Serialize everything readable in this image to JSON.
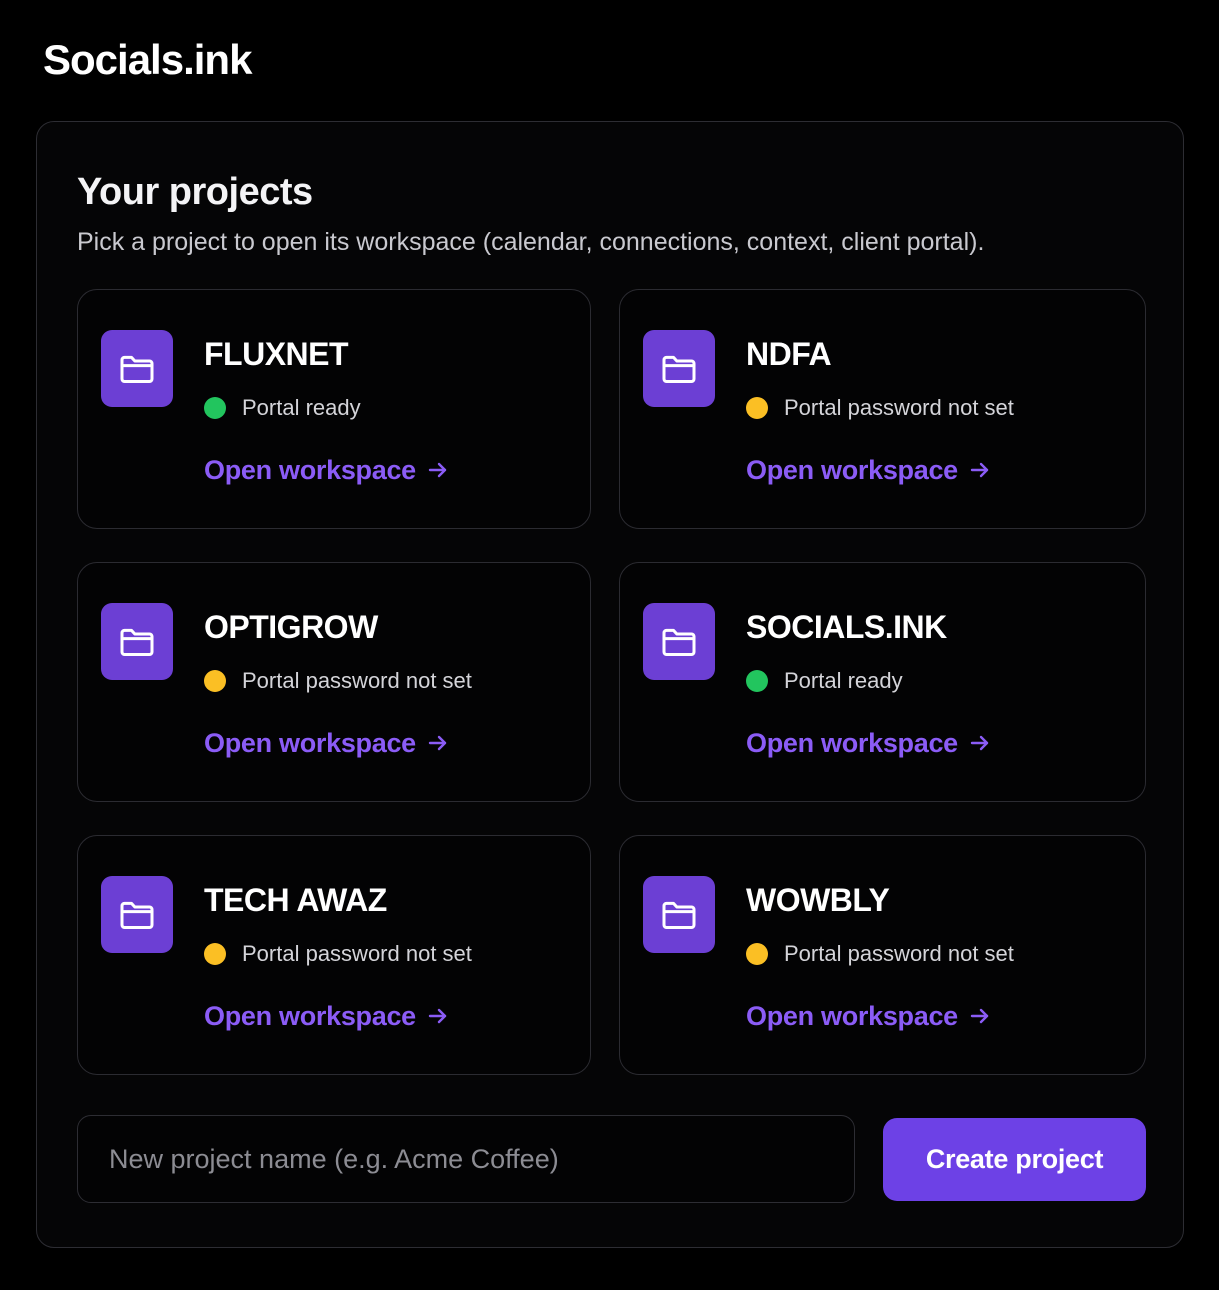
{
  "app": {
    "brand": "Socials.ink"
  },
  "projects_panel": {
    "title": "Your projects",
    "subtitle": "Pick a project to open its workspace (calendar, connections, context, client portal).",
    "open_label": "Open workspace",
    "icon": "folder-icon",
    "link_icon": "arrow-right-icon",
    "projects": [
      {
        "name": "FLUXNET",
        "status": "Portal ready",
        "status_kind": "ready"
      },
      {
        "name": "NDFA",
        "status": "Portal password not set",
        "status_kind": "warning"
      },
      {
        "name": "OPTIGROW",
        "status": "Portal password not set",
        "status_kind": "warning"
      },
      {
        "name": "SOCIALS.INK",
        "status": "Portal ready",
        "status_kind": "ready"
      },
      {
        "name": "TECH AWAZ",
        "status": "Portal password not set",
        "status_kind": "warning"
      },
      {
        "name": "WOWBLY",
        "status": "Portal password not set",
        "status_kind": "warning"
      }
    ]
  },
  "new_project": {
    "value": "",
    "placeholder": "New project name (e.g. Acme Coffee)",
    "create_label": "Create project"
  },
  "colors": {
    "accent": "#6d41e6",
    "link": "#8b5cf6",
    "icon_bg": "#6c3fd4",
    "status_ready": "#22c55e",
    "status_warning": "#fbbf24"
  }
}
